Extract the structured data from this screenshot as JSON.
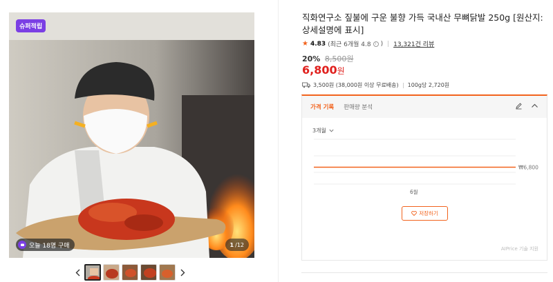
{
  "gallery": {
    "badge": "슈퍼적립",
    "recent_buyers": "오늘 18명 구매",
    "current_index": "1",
    "total": "12",
    "counter_sep": " / "
  },
  "product": {
    "title": "직화연구소 짚불에 구운 불향 가득 국내산 무뼈닭발 250g [원산지: 상세설명에 표시]",
    "rating": "4.83",
    "recent_rating": "(최근 6개월 4.8",
    "recent_rating_close": ")",
    "review_count": "13,321건 리뷰",
    "discount": "20%",
    "original_price": "8,500원",
    "price": "6,800",
    "price_unit": "원",
    "shipping": "3,500원 (38,000원 이상 무료배송)",
    "unit_price": "100g당 2,720원"
  },
  "price_panel": {
    "tab_history": "가격 기록",
    "tab_sales": "판매량 분석",
    "period": "3개월",
    "save_label": "저장하기",
    "powered_by": "AIPrice 기술 지원"
  },
  "chart_data": {
    "type": "line",
    "x": [
      "6월"
    ],
    "series": [
      {
        "values": [
          6800
        ]
      }
    ],
    "value_label": "₩6,800",
    "xlabel": "",
    "ylabel": "",
    "grid": true
  },
  "colors": {
    "accent": "#f2621c",
    "price_red": "#e0201d",
    "badge_purple": "#7b3fe4"
  }
}
